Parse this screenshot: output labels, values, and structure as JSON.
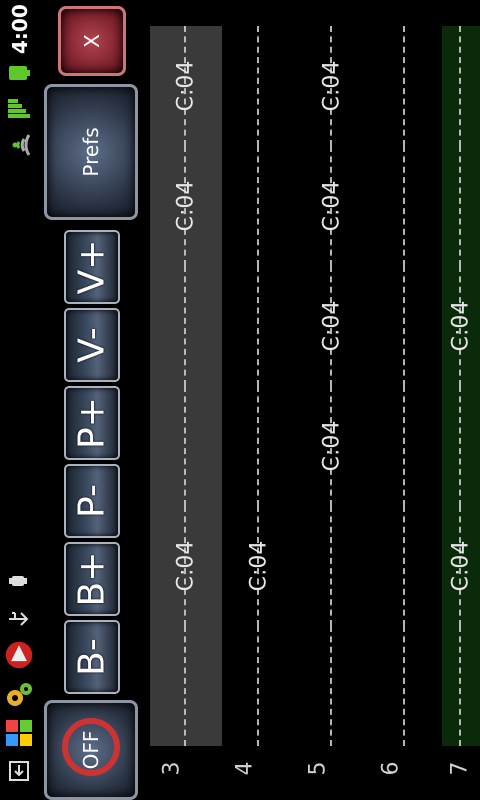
{
  "status": {
    "time": "4:00"
  },
  "buttons": {
    "close": "X",
    "prefs": "Prefs",
    "v_plus": "V+",
    "v_minus": "V-",
    "p_plus": "P+",
    "p_minus": "P-",
    "b_plus": "B+",
    "b_minus": "B-",
    "off": "OFF"
  },
  "rows": [
    "3",
    "4",
    "5",
    "6",
    "7"
  ],
  "notes": {
    "c1": [
      "C:04",
      "C:04",
      "",
      "",
      "C:04",
      ""
    ],
    "c2": [
      "",
      "",
      "",
      "",
      "C:04",
      ""
    ],
    "c3": [
      "C:04",
      "C:04",
      "C:04",
      "C:04",
      "",
      ""
    ],
    "c4": [
      "",
      "",
      "",
      "",
      "",
      ""
    ],
    "c5": [
      "",
      "",
      "C:04",
      "",
      "C:04",
      ""
    ]
  }
}
